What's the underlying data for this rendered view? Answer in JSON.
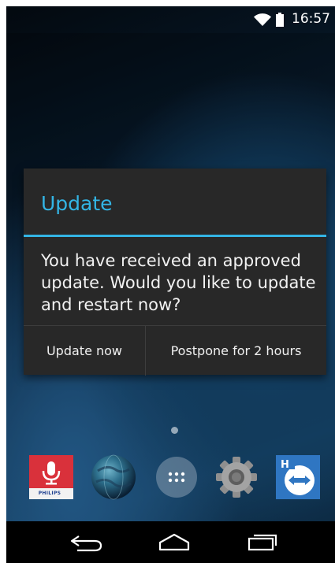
{
  "status_bar": {
    "time": "16:57",
    "wifi_icon": "wifi-icon",
    "battery_icon": "battery-icon"
  },
  "dialog": {
    "title": "Update",
    "message": "You have received an approved update. Would you like to update and restart now?",
    "buttons": {
      "update_now": "Update now",
      "postpone": "Postpone for 2 hours"
    },
    "accent_color": "#33b5e5",
    "background_color": "#282828"
  },
  "home_screen": {
    "dock": [
      {
        "name": "philips-app-icon",
        "label": "PHILIPS"
      },
      {
        "name": "globe-app-icon"
      },
      {
        "name": "app-drawer-icon"
      },
      {
        "name": "settings-gear-icon"
      },
      {
        "name": "teamviewer-app-icon"
      }
    ]
  },
  "nav_bar": {
    "back": "back-icon",
    "home": "home-icon",
    "recents": "recents-icon"
  }
}
